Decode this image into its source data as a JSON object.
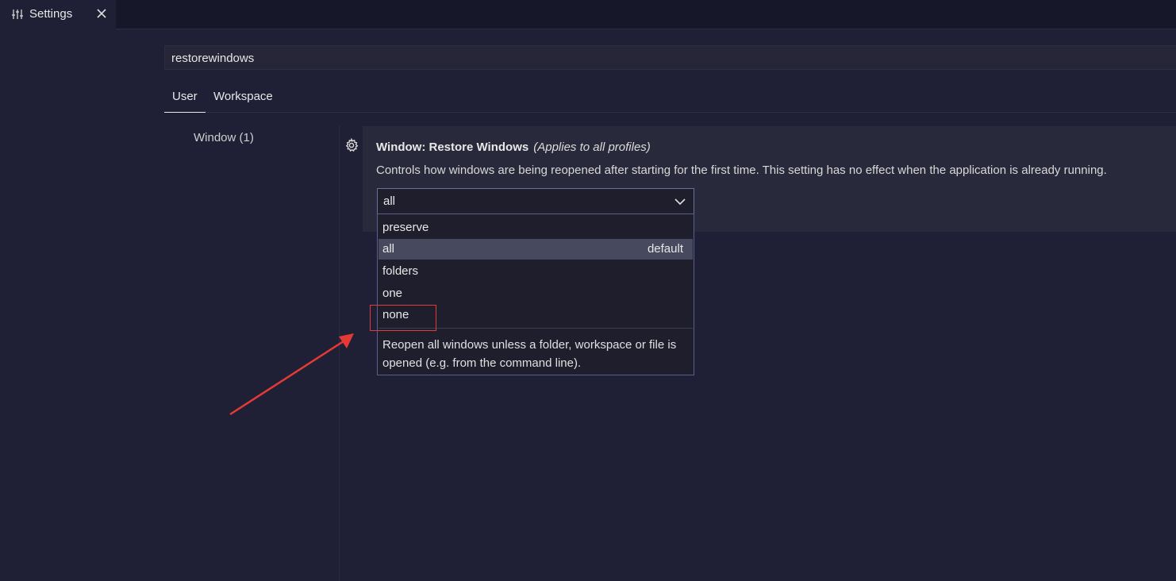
{
  "tab": {
    "label": "Settings",
    "icon": "settings-sliders-icon",
    "close_icon": "close-icon"
  },
  "search": {
    "value": "restorewindows"
  },
  "scope_tabs": {
    "user": "User",
    "workspace": "Workspace"
  },
  "toc": {
    "item": "Window (1)"
  },
  "setting": {
    "title": "Window: Restore Windows",
    "scope_note": "(Applies to all profiles)",
    "description": "Controls how windows are being reopened after starting for the first time. This setting has no effect when the application is already running.",
    "current_value": "all"
  },
  "dropdown": {
    "options": [
      {
        "label": "preserve"
      },
      {
        "label": "all",
        "badge": "default",
        "selected": true
      },
      {
        "label": "folders"
      },
      {
        "label": "one"
      },
      {
        "label": "none"
      }
    ],
    "option_description": "Reopen all windows unless a folder, workspace or file is opened (e.g. from the command line)."
  },
  "annotation": {
    "highlighted_option": "none",
    "color": "#e13b3b"
  },
  "colors": {
    "background": "#1f2035",
    "card": "#29293c",
    "selected_option": "#474a5e"
  }
}
